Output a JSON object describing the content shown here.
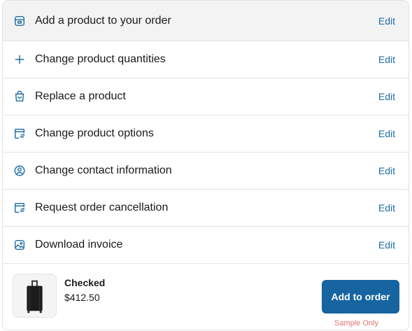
{
  "actions": [
    {
      "label": "Add a product to your order",
      "edit": "Edit",
      "icon": "product-box-icon"
    },
    {
      "label": "Change product quantities",
      "edit": "Edit",
      "icon": "plus-icon"
    },
    {
      "label": "Replace a product",
      "edit": "Edit",
      "icon": "shopping-bag-icon"
    },
    {
      "label": "Change product options",
      "edit": "Edit",
      "icon": "box-swap-icon"
    },
    {
      "label": "Change contact information",
      "edit": "Edit",
      "icon": "user-circle-icon"
    },
    {
      "label": "Request order cancellation",
      "edit": "Edit",
      "icon": "box-return-icon"
    },
    {
      "label": "Download invoice",
      "edit": "Edit",
      "icon": "image-icon"
    }
  ],
  "product": {
    "name": "Checked",
    "price": "$412.50",
    "add_button": "Add to order",
    "sample_label": "Sample Only"
  },
  "colors": {
    "accent": "#1664a0",
    "link": "#1f6ea3",
    "sample": "#e4736b",
    "highlight_row": "#f3f3f3"
  }
}
